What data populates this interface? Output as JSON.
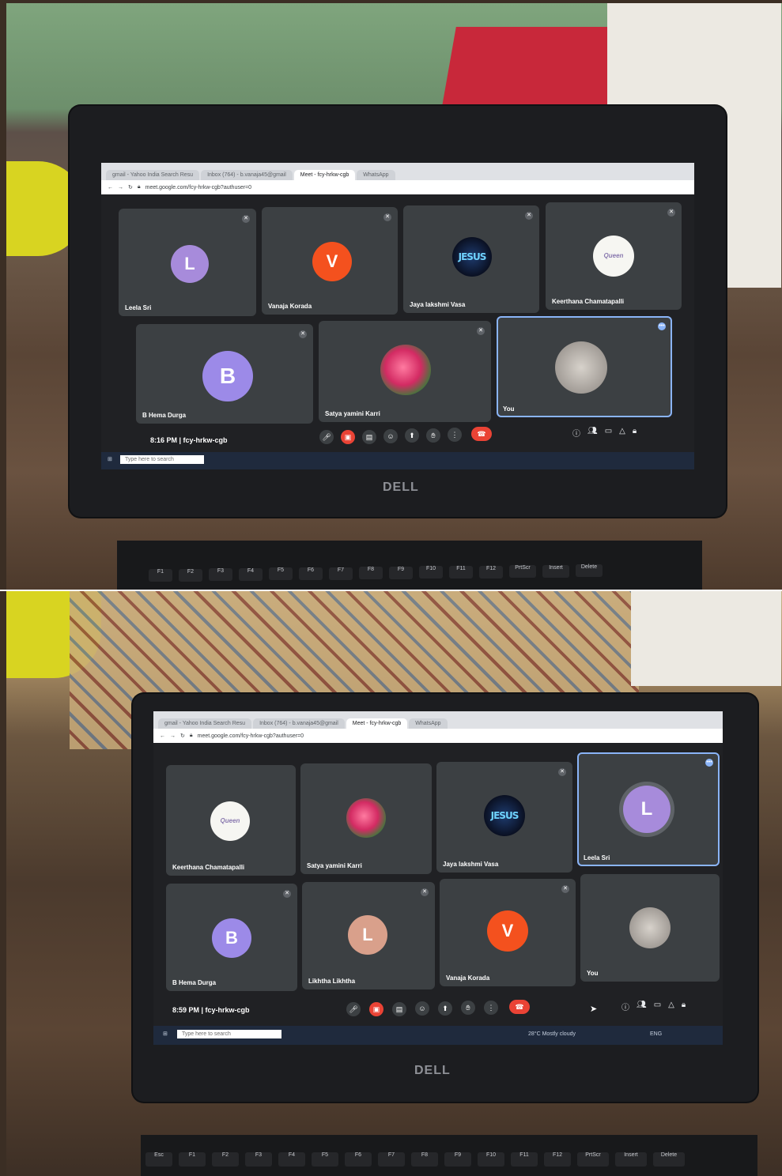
{
  "shot1": {
    "tabs": [
      "gmail - Yahoo India Search Resu",
      "Inbox (764) - b.vanaja45@gmail",
      "Meet - fcy-hrkw-cgb",
      "WhatsApp"
    ],
    "url": "meet.google.com/fcy-hrkw-cgb?authuser=0",
    "participants": [
      {
        "name": "Leela Sri",
        "initial": "L",
        "color": "#a78bdb"
      },
      {
        "name": "Vanaja Korada",
        "initial": "V",
        "color": "#f4511e"
      },
      {
        "name": "Jaya lakshmi Vasa",
        "initial": "JESUS",
        "color": "#0a1022"
      },
      {
        "name": "Keerthana Chamatapalli",
        "initial": "",
        "color": "#f6f6f2"
      },
      {
        "name": "B Hema Durga",
        "initial": "B",
        "color": "#9c8ae8"
      },
      {
        "name": "Satya yamini Karri",
        "initial": "",
        "color": "#d32b63"
      },
      {
        "name": "You",
        "initial": "",
        "color": "#8b8580"
      }
    ],
    "clock": "8:16 PM",
    "meeting_code": "fcy-hrkw-cgb",
    "taskbar_search": "Type here to search"
  },
  "shot2": {
    "tabs": [
      "gmail - Yahoo India Search Resu",
      "Inbox (764) - b.vanaja45@gmail",
      "Meet - fcy-hrkw-cgb",
      "WhatsApp"
    ],
    "url": "meet.google.com/fcy-hrkw-cgb?authuser=0",
    "participants": [
      {
        "name": "Keerthana Chamatapalli",
        "initial": "",
        "color": "#f6f6f2"
      },
      {
        "name": "Satya yamini Karri",
        "initial": "",
        "color": "#d32b63"
      },
      {
        "name": "Jaya lakshmi Vasa",
        "initial": "JESUS",
        "color": "#0a1022"
      },
      {
        "name": "Leela Sri",
        "initial": "L",
        "color": "#a78bdb"
      },
      {
        "name": "B Hema Durga",
        "initial": "B",
        "color": "#9c8ae8"
      },
      {
        "name": "Likhtha Likhtha",
        "initial": "L",
        "color": "#d9a08b"
      },
      {
        "name": "Vanaja Korada",
        "initial": "V",
        "color": "#f4511e"
      },
      {
        "name": "You",
        "initial": "",
        "color": "#8b8580"
      }
    ],
    "clock": "8:59 PM",
    "meeting_code": "fcy-hrkw-cgb",
    "taskbar_search": "Type here to search",
    "weather": "28°C  Mostly cloudy",
    "lang": "ENG"
  },
  "brand": "DELL",
  "keys": [
    "Esc",
    "F1",
    "F2",
    "F3",
    "F4",
    "F5",
    "F6",
    "F7",
    "F8",
    "F9",
    "F10",
    "F11",
    "F12",
    "PrtScr",
    "Insert",
    "Delete"
  ]
}
